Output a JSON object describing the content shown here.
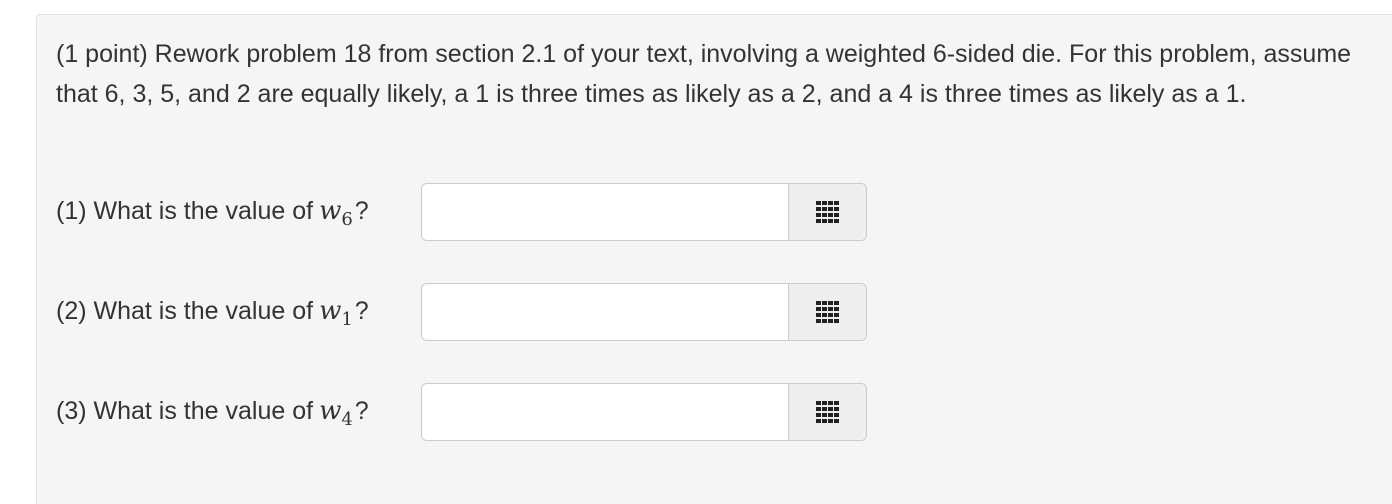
{
  "problem": {
    "text": "(1 point) Rework problem 18 from section 2.1 of your text, involving a weighted 6-sided die. For this problem, assume that 6, 3, 5, and 2 are equally likely, a 1 is three times as likely as a 2, and a 4 is three times as likely as a 1."
  },
  "questions": [
    {
      "prefix": "(1) What is the value of",
      "var": "w",
      "sub": "6",
      "suffix": "?",
      "value": "",
      "placeholder": ""
    },
    {
      "prefix": "(2) What is the value of",
      "var": "w",
      "sub": "1",
      "suffix": "?",
      "value": "",
      "placeholder": ""
    },
    {
      "prefix": "(3) What is the value of",
      "var": "w",
      "sub": "4",
      "suffix": "?",
      "value": "",
      "placeholder": ""
    }
  ],
  "icons": {
    "equation_editor": "grid-icon"
  },
  "colors": {
    "panel_background": "#f5f5f5",
    "addon_background": "#eeeeee",
    "text": "#333333",
    "border": "#cccccc"
  }
}
